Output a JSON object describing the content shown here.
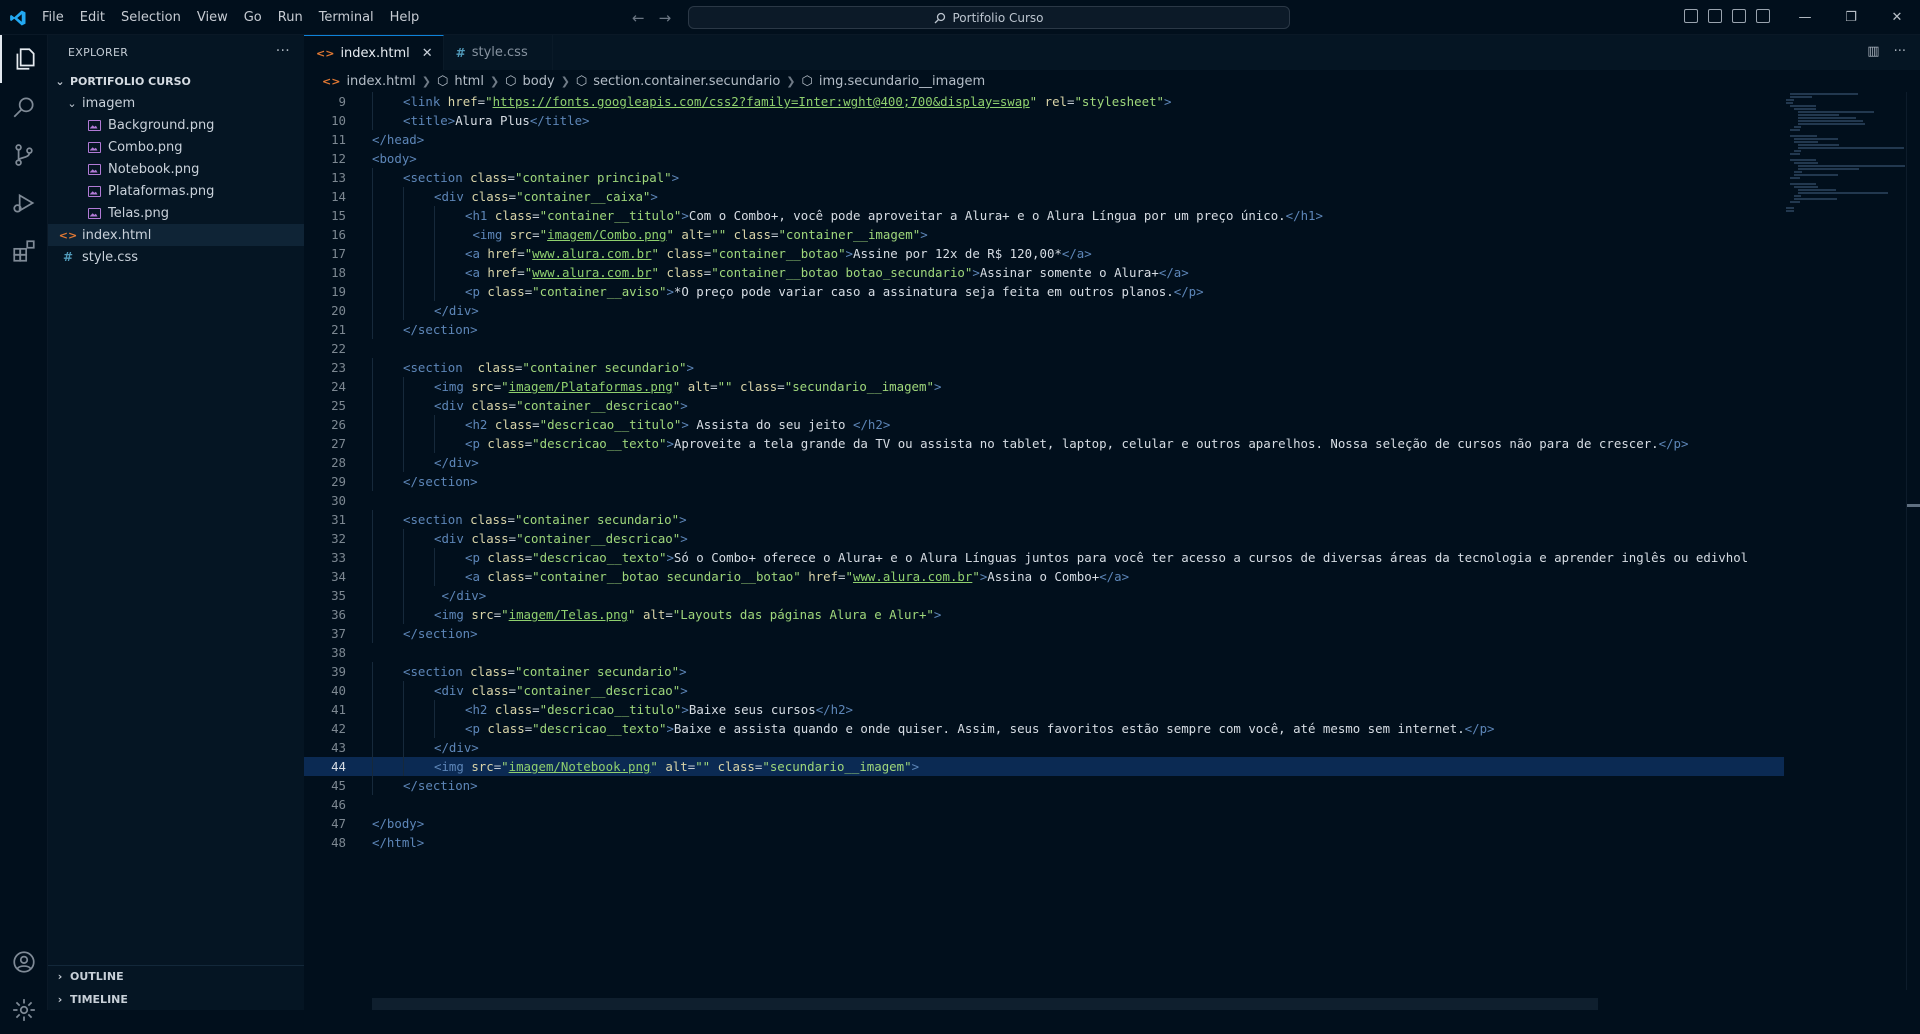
{
  "menu": [
    "File",
    "Edit",
    "Selection",
    "View",
    "Go",
    "Run",
    "Terminal",
    "Help"
  ],
  "search": {
    "label": "Portifolio Curso"
  },
  "explorer": {
    "title": "EXPLORER",
    "root": "PORTIFOLIO CURSO",
    "folder": "imagem",
    "images": [
      "Background.png",
      "Combo.png",
      "Notebook.png",
      "Plataformas.png",
      "Telas.png"
    ],
    "files": [
      "index.html",
      "style.css"
    ],
    "outline": "OUTLINE",
    "timeline": "TIMELINE"
  },
  "tabs": [
    {
      "label": "index.html",
      "active": true
    },
    {
      "label": "style.css",
      "active": false
    }
  ],
  "breadcrumb": [
    "index.html",
    "html",
    "body",
    "section.container.secundario",
    "img.secundario__imagem"
  ],
  "editor": {
    "current_line": 44,
    "lines": [
      {
        "n": "9",
        "indent": 1,
        "html": "<span class=tag>&lt;link</span> <span class=attr>href</span><span class=punc>=</span><span class=str>\"</span><span class=url>https://fonts.googleapis.com/css2?family=Inter:wght@400;700&amp;display=swap</span><span class=str>\"</span> <span class=attr>rel</span><span class=punc>=</span><span class=str>\"stylesheet\"</span><span class=tag>&gt;</span>"
      },
      {
        "n": "10",
        "indent": 1,
        "html": "<span class=tag>&lt;title&gt;</span>Alura Plus<span class=tag>&lt;/title&gt;</span>"
      },
      {
        "n": "11",
        "indent": 0,
        "html": "<span class=tag>&lt;/head&gt;</span>"
      },
      {
        "n": "12",
        "indent": 0,
        "html": "<span class=tag>&lt;body&gt;</span>"
      },
      {
        "n": "13",
        "indent": 1,
        "html": "<span class=tag>&lt;section</span> <span class=attr>class</span><span class=punc>=</span><span class=str>\"container principal\"</span><span class=tag>&gt;</span>"
      },
      {
        "n": "14",
        "indent": 2,
        "html": "<span class=tag>&lt;div</span> <span class=attr>class</span><span class=punc>=</span><span class=str>\"container__caixa\"</span><span class=tag>&gt;</span>"
      },
      {
        "n": "15",
        "indent": 3,
        "html": "<span class=tag>&lt;h1</span> <span class=attr>class</span><span class=punc>=</span><span class=str>\"container__titulo\"</span><span class=tag>&gt;</span>Com o Combo+, você pode aproveitar a Alura+ e o Alura Língua por um preço único.<span class=tag>&lt;/h1&gt;</span>"
      },
      {
        "n": "16",
        "indent": 3,
        "html": " <span class=tag>&lt;img</span> <span class=attr>src</span><span class=punc>=</span><span class=str>\"</span><span class=url>imagem/Combo.png</span><span class=str>\"</span> <span class=attr>alt</span><span class=punc>=</span><span class=str>\"\"</span> <span class=attr>class</span><span class=punc>=</span><span class=str>\"container__imagem\"</span><span class=tag>&gt;</span>"
      },
      {
        "n": "17",
        "indent": 3,
        "html": "<span class=tag>&lt;a</span> <span class=attr>href</span><span class=punc>=</span><span class=str>\"</span><span class=url>www.alura.com.br</span><span class=str>\"</span> <span class=attr>class</span><span class=punc>=</span><span class=str>\"container__botao\"</span><span class=tag>&gt;</span>Assine por 12x de R$ 120,00*<span class=tag>&lt;/a&gt;</span>"
      },
      {
        "n": "18",
        "indent": 3,
        "html": "<span class=tag>&lt;a</span> <span class=attr>href</span><span class=punc>=</span><span class=str>\"</span><span class=url>www.alura.com.br</span><span class=str>\"</span> <span class=attr>class</span><span class=punc>=</span><span class=str>\"container__botao botao_secundario\"</span><span class=tag>&gt;</span>Assinar somente o Alura+<span class=tag>&lt;/a&gt;</span>"
      },
      {
        "n": "19",
        "indent": 3,
        "html": "<span class=tag>&lt;p</span> <span class=attr>class</span><span class=punc>=</span><span class=str>\"container__aviso\"</span><span class=tag>&gt;</span>*O preço pode variar caso a assinatura seja feita em outros planos.<span class=tag>&lt;/p&gt;</span>"
      },
      {
        "n": "20",
        "indent": 2,
        "html": "<span class=tag>&lt;/div&gt;</span>"
      },
      {
        "n": "21",
        "indent": 1,
        "html": "<span class=tag>&lt;/section&gt;</span>"
      },
      {
        "n": "22",
        "indent": 0,
        "html": ""
      },
      {
        "n": "23",
        "indent": 1,
        "html": "<span class=tag>&lt;section</span>  <span class=attr>class</span><span class=punc>=</span><span class=str>\"container secundario\"</span><span class=tag>&gt;</span>"
      },
      {
        "n": "24",
        "indent": 2,
        "html": "<span class=tag>&lt;img</span> <span class=attr>src</span><span class=punc>=</span><span class=str>\"</span><span class=url>imagem/Plataformas.png</span><span class=str>\"</span> <span class=attr>alt</span><span class=punc>=</span><span class=str>\"\"</span> <span class=attr>class</span><span class=punc>=</span><span class=str>\"secundario__imagem\"</span><span class=tag>&gt;</span>"
      },
      {
        "n": "25",
        "indent": 2,
        "html": "<span class=tag>&lt;div</span> <span class=attr>class</span><span class=punc>=</span><span class=str>\"container__descricao\"</span><span class=tag>&gt;</span>"
      },
      {
        "n": "26",
        "indent": 3,
        "html": "<span class=tag>&lt;h2</span> <span class=attr>class</span><span class=punc>=</span><span class=str>\"descricao__titulo\"</span><span class=tag>&gt;</span> Assista do seu jeito <span class=tag>&lt;/h2&gt;</span>"
      },
      {
        "n": "27",
        "indent": 3,
        "html": "<span class=tag>&lt;p</span> <span class=attr>class</span><span class=punc>=</span><span class=str>\"descricao__texto\"</span><span class=tag>&gt;</span>Aproveite a tela grande da TV ou assista no tablet, laptop, celular e outros aparelhos. Nossa seleção de cursos não para de crescer.<span class=tag>&lt;/p&gt;</span>"
      },
      {
        "n": "28",
        "indent": 2,
        "html": "<span class=tag>&lt;/div&gt;</span>"
      },
      {
        "n": "29",
        "indent": 1,
        "html": "<span class=tag>&lt;/section&gt;</span>"
      },
      {
        "n": "30",
        "indent": 0,
        "html": ""
      },
      {
        "n": "31",
        "indent": 1,
        "html": "<span class=tag>&lt;section</span> <span class=attr>class</span><span class=punc>=</span><span class=str>\"container secundario\"</span><span class=tag>&gt;</span>"
      },
      {
        "n": "32",
        "indent": 2,
        "html": "<span class=tag>&lt;div</span> <span class=attr>class</span><span class=punc>=</span><span class=str>\"container__descricao\"</span><span class=tag>&gt;</span>"
      },
      {
        "n": "33",
        "indent": 3,
        "html": "<span class=tag>&lt;p</span> <span class=attr>class</span><span class=punc>=</span><span class=str>\"descricao__texto\"</span><span class=tag>&gt;</span>Só o Combo+ oferece o Alura+ e o Alura Línguas juntos para você ter acesso a cursos de diversas áreas da tecnologia e aprender inglês ou edivhol"
      },
      {
        "n": "34",
        "indent": 3,
        "html": "<span class=tag>&lt;a</span> <span class=attr>class</span><span class=punc>=</span><span class=str>\"container__botao secundario__botao\"</span> <span class=attr>href</span><span class=punc>=</span><span class=str>\"</span><span class=url>www.alura.com.br</span><span class=str>\"</span><span class=tag>&gt;</span>Assina o Combo+<span class=tag>&lt;/a&gt;</span>"
      },
      {
        "n": "35",
        "indent": 2,
        "html": " <span class=tag>&lt;/div&gt;</span>"
      },
      {
        "n": "36",
        "indent": 2,
        "html": "<span class=tag>&lt;img</span> <span class=attr>src</span><span class=punc>=</span><span class=str>\"</span><span class=url>imagem/Telas.png</span><span class=str>\"</span> <span class=attr>alt</span><span class=punc>=</span><span class=str>\"Layouts das páginas Alura e Alur+\"</span><span class=tag>&gt;</span>"
      },
      {
        "n": "37",
        "indent": 1,
        "html": "<span class=tag>&lt;/section&gt;</span>"
      },
      {
        "n": "38",
        "indent": 0,
        "html": ""
      },
      {
        "n": "39",
        "indent": 1,
        "html": "<span class=tag>&lt;section</span> <span class=attr>class</span><span class=punc>=</span><span class=str>\"container secundario\"</span><span class=tag>&gt;</span>"
      },
      {
        "n": "40",
        "indent": 2,
        "html": "<span class=tag>&lt;div</span> <span class=attr>class</span><span class=punc>=</span><span class=str>\"container__descricao\"</span><span class=tag>&gt;</span>"
      },
      {
        "n": "41",
        "indent": 3,
        "html": "<span class=tag>&lt;h2</span> <span class=attr>class</span><span class=punc>=</span><span class=str>\"descricao__titulo\"</span><span class=tag>&gt;</span>Baixe seus cursos<span class=tag>&lt;/h2&gt;</span>"
      },
      {
        "n": "42",
        "indent": 3,
        "html": "<span class=tag>&lt;p</span> <span class=attr>class</span><span class=punc>=</span><span class=str>\"descricao__texto\"</span><span class=tag>&gt;</span>Baixe e assista quando e onde quiser. Assim, seus favoritos estão sempre com você, até mesmo sem internet.<span class=tag>&lt;/p&gt;</span>"
      },
      {
        "n": "43",
        "indent": 2,
        "html": "<span class=tag>&lt;/div&gt;</span>"
      },
      {
        "n": "44",
        "indent": 2,
        "html": "<span class=tag>&lt;img</span> <span class=attr>src</span><span class=punc>=</span><span class=str>\"</span><span class=url>imagem/Notebook.png</span><span class=str>\"</span> <span class=attr>alt</span><span class=punc>=</span><span class=str>\"\"</span> <span class=attr>class</span><span class=punc>=</span><span class=str>\"secundario__imagem\"</span><span class=tag>&gt;</span>"
      },
      {
        "n": "45",
        "indent": 1,
        "html": "<span class=tag>&lt;/section&gt;</span>"
      },
      {
        "n": "46",
        "indent": 0,
        "html": ""
      },
      {
        "n": "47",
        "indent": 0,
        "html": "<span class=tag>&lt;/body&gt;</span>"
      },
      {
        "n": "48",
        "indent": 0,
        "html": "<span class=tag>&lt;/html&gt;</span>"
      }
    ]
  },
  "colors": {
    "background": "#010f1c",
    "sidebar": "#051523",
    "accent": "#0e82d8",
    "current_line": "#0b2a53"
  }
}
